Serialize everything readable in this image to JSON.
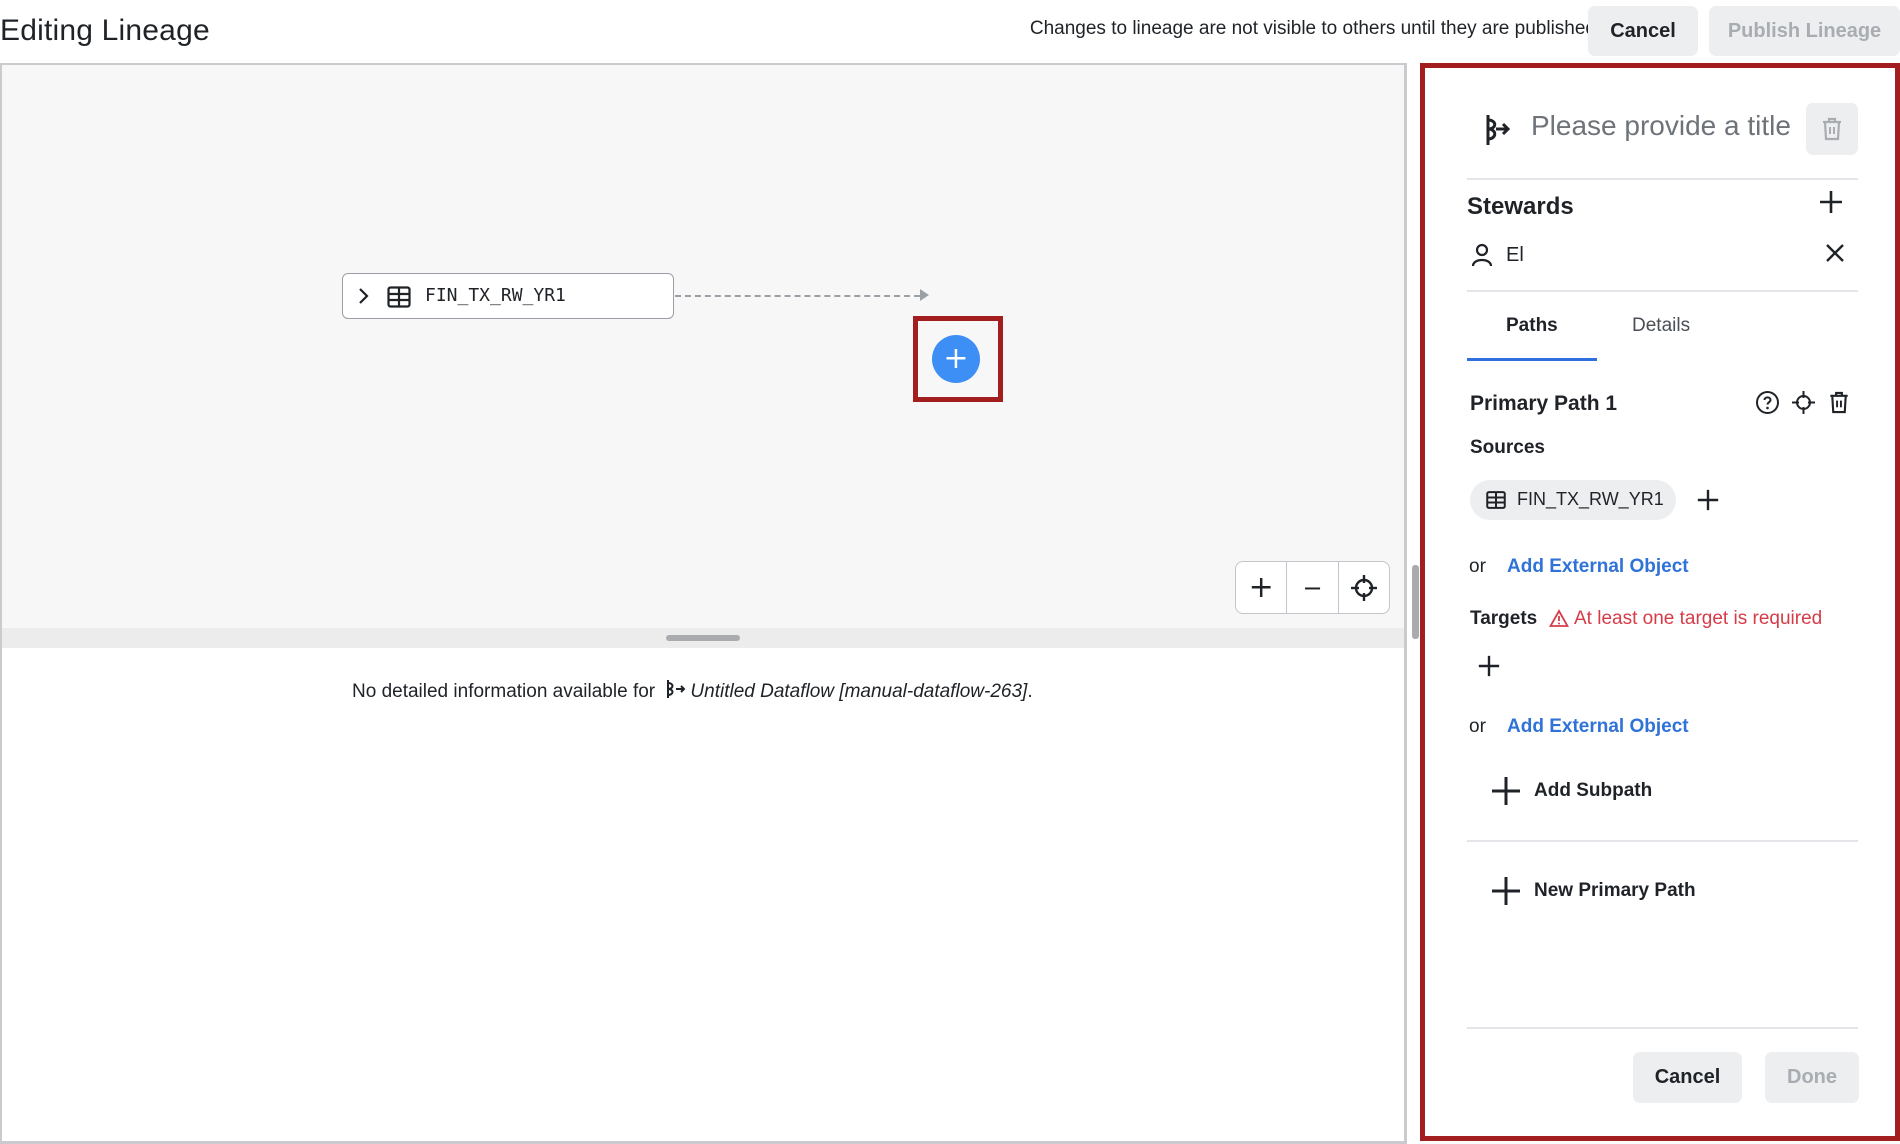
{
  "header": {
    "title": "Editing Lineage",
    "notice": "Changes to lineage are not visible to others until they are published",
    "cancel_label": "Cancel",
    "publish_label": "Publish Lineage"
  },
  "canvas": {
    "node_label": "FIN_TX_RW_YR1",
    "add_node_glyph": "+",
    "zoom_in_glyph": "+",
    "zoom_out_glyph": "−"
  },
  "details": {
    "message_prefix": "No detailed information available for",
    "dataflow_name": "Untitled Dataflow [manual-dataflow-263]",
    "message_suffix": "."
  },
  "panel": {
    "title_placeholder": "Please provide a title",
    "stewards_label": "Stewards",
    "steward_name": "El",
    "tabs": [
      {
        "label": "Paths",
        "active": true
      },
      {
        "label": "Details",
        "active": false
      }
    ],
    "path": {
      "title": "Primary Path 1",
      "sources_label": "Sources",
      "source_chip": "FIN_TX_RW_YR1",
      "or_label": "or",
      "add_external_label": "Add External Object",
      "targets_label": "Targets",
      "targets_warning": "At least one target is required",
      "add_subpath_label": "Add Subpath"
    },
    "new_primary_path_label": "New Primary Path",
    "cancel_label": "Cancel",
    "done_label": "Done"
  },
  "colors": {
    "accent": "#3d8ef5",
    "link": "#2f73d8",
    "warning": "#d63c48",
    "highlight": "#a31f1f",
    "tab_underline": "#2f6fe0"
  },
  "icons": {
    "node_expand": "chevron-right-icon",
    "table": "table-icon",
    "dataflow": "dataflow-icon",
    "trash": "trash-icon",
    "user": "user-icon",
    "close": "close-icon",
    "help": "help-circle-icon",
    "locate": "crosshair-icon",
    "warning": "warning-triangle-icon"
  }
}
